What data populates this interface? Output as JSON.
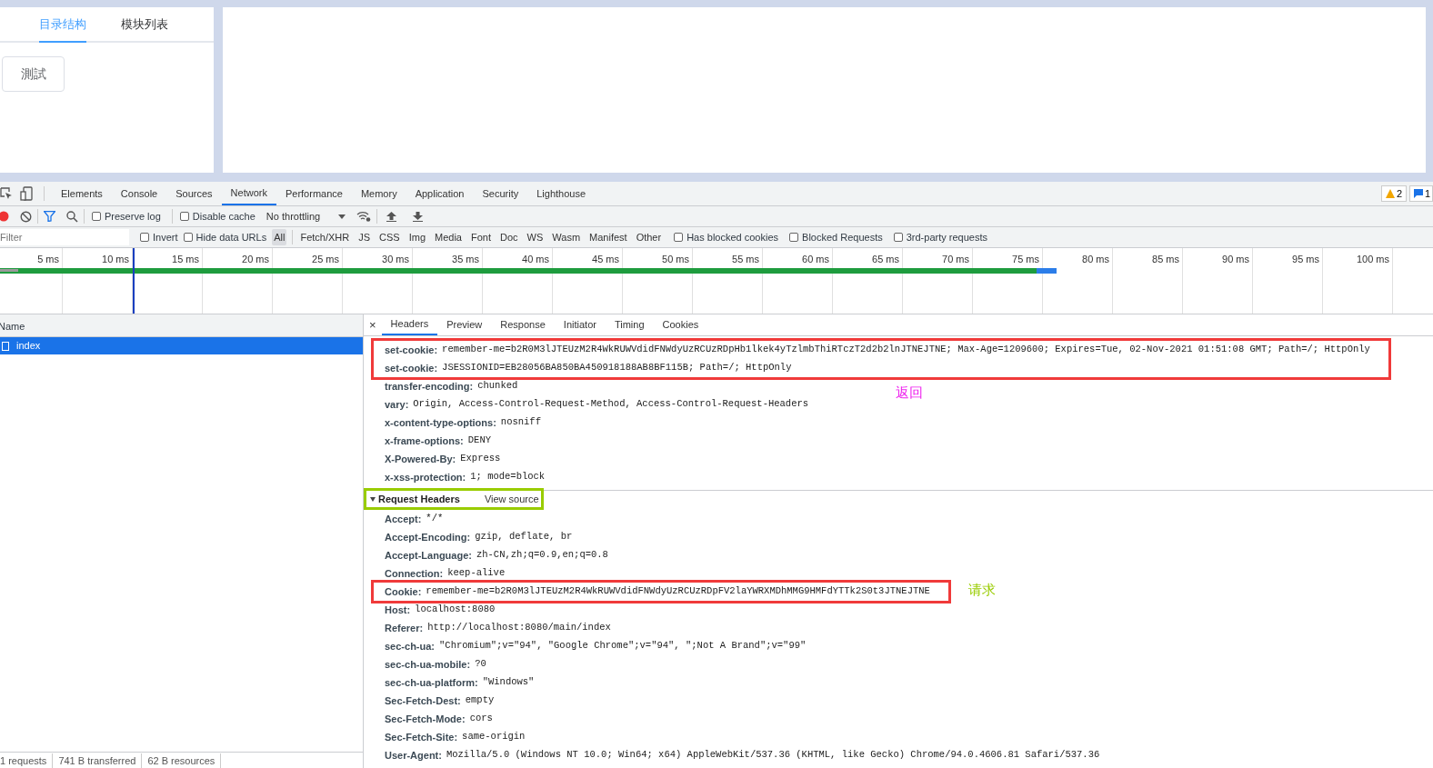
{
  "app": {
    "tabs": [
      {
        "label": "目录结构",
        "selected": true
      },
      {
        "label": "模块列表",
        "selected": false
      }
    ],
    "button": "測試"
  },
  "devtools": {
    "tabs": [
      {
        "label": "Elements",
        "selected": false
      },
      {
        "label": "Console",
        "selected": false
      },
      {
        "label": "Sources",
        "selected": false
      },
      {
        "label": "Network",
        "selected": true
      },
      {
        "label": "Performance",
        "selected": false
      },
      {
        "label": "Memory",
        "selected": false
      },
      {
        "label": "Application",
        "selected": false
      },
      {
        "label": "Security",
        "selected": false
      },
      {
        "label": "Lighthouse",
        "selected": false
      }
    ],
    "warning_count": "2",
    "message_count": "1",
    "toolbar": {
      "recording": true,
      "checks": [
        {
          "label": "Preserve log",
          "checked": false
        },
        {
          "label": "Disable cache",
          "checked": false
        }
      ],
      "throttling": "No throttling"
    },
    "filter": {
      "placeholder": "Filter",
      "checks": [
        {
          "label": "Invert",
          "checked": false
        },
        {
          "label": "Hide data URLs",
          "checked": false
        }
      ],
      "types": [
        {
          "label": "All",
          "selected": true
        },
        {
          "label": "Fetch/XHR",
          "selected": false
        },
        {
          "label": "JS",
          "selected": false
        },
        {
          "label": "CSS",
          "selected": false
        },
        {
          "label": "Img",
          "selected": false
        },
        {
          "label": "Media",
          "selected": false
        },
        {
          "label": "Font",
          "selected": false
        },
        {
          "label": "Doc",
          "selected": false
        },
        {
          "label": "WS",
          "selected": false
        },
        {
          "label": "Wasm",
          "selected": false
        },
        {
          "label": "Manifest",
          "selected": false
        },
        {
          "label": "Other",
          "selected": false
        }
      ],
      "extra_checks": [
        {
          "label": "Has blocked cookies",
          "checked": false
        },
        {
          "label": "Blocked Requests",
          "checked": false
        },
        {
          "label": "3rd-party requests",
          "checked": false
        }
      ]
    },
    "timeline_ticks": [
      "5 ms",
      "10 ms",
      "15 ms",
      "20 ms",
      "25 ms",
      "30 ms",
      "35 ms",
      "40 ms",
      "45 ms",
      "50 ms",
      "55 ms",
      "60 ms",
      "65 ms",
      "70 ms",
      "75 ms",
      "80 ms",
      "85 ms",
      "90 ms",
      "95 ms",
      "100 ms"
    ],
    "requests": {
      "column": "Name",
      "rows": [
        {
          "name": "index",
          "selected": true
        }
      ]
    },
    "status_bar": [
      "1 requests",
      "741 B transferred",
      "62 B resources"
    ],
    "detail": {
      "close": "×",
      "tabs": [
        {
          "label": "Headers",
          "selected": true
        },
        {
          "label": "Preview",
          "selected": false
        },
        {
          "label": "Response",
          "selected": false
        },
        {
          "label": "Initiator",
          "selected": false
        },
        {
          "label": "Timing",
          "selected": false
        },
        {
          "label": "Cookies",
          "selected": false
        }
      ],
      "response_headers": [
        {
          "name": "set-cookie:",
          "value": "remember-me=b2R0M3lJTEUzM2R4WkRUWVdidFNWdyUzRCUzRDpHb1lkek4yTzlmbThiRTczT2d2b2lnJTNEJTNE; Max-Age=1209600; Expires=Tue, 02-Nov-2021 01:51:08 GMT; Path=/; HttpOnly",
          "boxed": true
        },
        {
          "name": "set-cookie:",
          "value": "JSESSIONID=EB28056BA850BA450918188AB8BF115B; Path=/; HttpOnly",
          "boxed": true
        },
        {
          "name": "transfer-encoding:",
          "value": "chunked",
          "boxed": false,
          "note": {
            "text": "返回",
            "color": "#ee22ee"
          }
        },
        {
          "name": "vary:",
          "value": "Origin, Access-Control-Request-Method, Access-Control-Request-Headers",
          "boxed": false
        },
        {
          "name": "x-content-type-options:",
          "value": "nosniff",
          "boxed": false
        },
        {
          "name": "x-frame-options:",
          "value": "DENY",
          "boxed": false
        },
        {
          "name": "X-Powered-By:",
          "value": "Express",
          "boxed": false
        },
        {
          "name": "x-xss-protection:",
          "value": "1; mode=block",
          "boxed": false
        }
      ],
      "request_section": {
        "title": "Request Headers",
        "link": "View source",
        "expanded": true
      },
      "request_headers": [
        {
          "name": "Accept:",
          "value": "*/*",
          "boxed": false
        },
        {
          "name": "Accept-Encoding:",
          "value": "gzip, deflate, br",
          "boxed": false
        },
        {
          "name": "Accept-Language:",
          "value": "zh-CN,zh;q=0.9,en;q=0.8",
          "boxed": false
        },
        {
          "name": "Connection:",
          "value": "keep-alive",
          "boxed": false
        },
        {
          "name": "Cookie:",
          "value": "remember-me=b2R0M3lJTEUzM2R4WkRUWVdidFNWdyUzRCUzRDpFV2laYWRXMDhMMG9HMFdYTTk2S0t3JTNEJTNE",
          "boxed": true,
          "note": {
            "text": "请求",
            "color": "#99cc00"
          }
        },
        {
          "name": "Host:",
          "value": "localhost:8080",
          "boxed": false
        },
        {
          "name": "Referer:",
          "value": "http://localhost:8080/main/index",
          "boxed": false
        },
        {
          "name": "sec-ch-ua:",
          "value": "\"Chromium\";v=\"94\", \"Google Chrome\";v=\"94\", \";Not A Brand\";v=\"99\"",
          "boxed": false
        },
        {
          "name": "sec-ch-ua-mobile:",
          "value": "?0",
          "boxed": false
        },
        {
          "name": "sec-ch-ua-platform:",
          "value": "\"Windows\"",
          "boxed": false
        },
        {
          "name": "Sec-Fetch-Dest:",
          "value": "empty",
          "boxed": false
        },
        {
          "name": "Sec-Fetch-Mode:",
          "value": "cors",
          "boxed": false
        },
        {
          "name": "Sec-Fetch-Site:",
          "value": "same-origin",
          "boxed": false
        },
        {
          "name": "User-Agent:",
          "value": "Mozilla/5.0 (Windows NT 10.0; Win64; x64) AppleWebKit/537.36 (KHTML, like Gecko) Chrome/94.0.4606.81 Safari/537.36",
          "boxed": false
        }
      ]
    }
  }
}
